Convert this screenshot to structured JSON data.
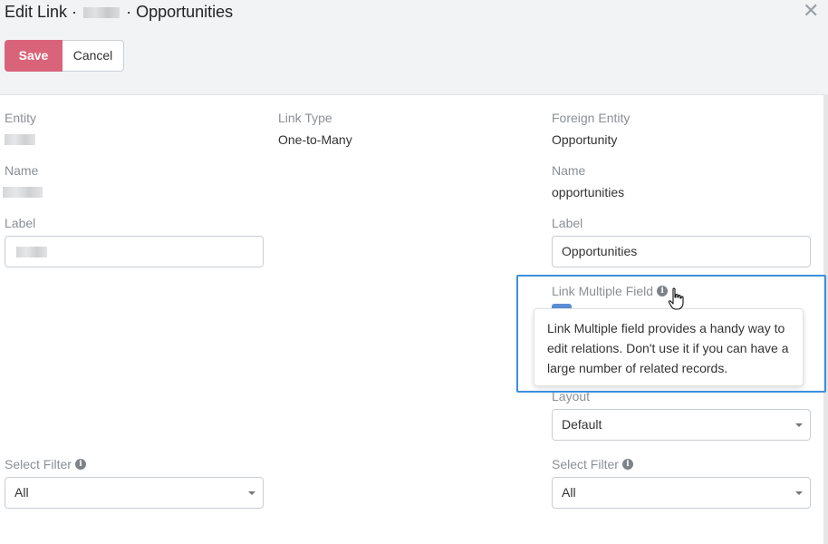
{
  "header": {
    "title_prefix": "Edit Link ·",
    "title_suffix": "· Opportunities",
    "save_label": "Save",
    "cancel_label": "Cancel"
  },
  "left": {
    "entity_label": "Entity",
    "name_label": "Name",
    "label_label": "Label",
    "select_filter_label": "Select Filter",
    "select_filter_value": "All"
  },
  "middle": {
    "link_type_label": "Link Type",
    "link_type_value": "One-to-Many"
  },
  "right": {
    "foreign_entity_label": "Foreign Entity",
    "foreign_entity_value": "Opportunity",
    "name_label": "Name",
    "name_value": "opportunities",
    "label_label": "Label",
    "label_value": "Opportunities",
    "link_multiple_label": "Link Multiple Field",
    "layout_label": "Layout",
    "layout_value": "Default",
    "select_filter_label": "Select Filter",
    "select_filter_value": "All"
  },
  "tooltip": {
    "text": "Link Multiple field provides a handy way to edit relations. Don't use it if you can have a large number of related records."
  },
  "colors": {
    "save_button": "#d9647a",
    "highlight_border": "#3b8fdc",
    "header_bg": "#f2f3f5"
  },
  "icons": [
    "close-icon",
    "info-icon",
    "caret-down-icon",
    "hand-pointer-icon"
  ]
}
